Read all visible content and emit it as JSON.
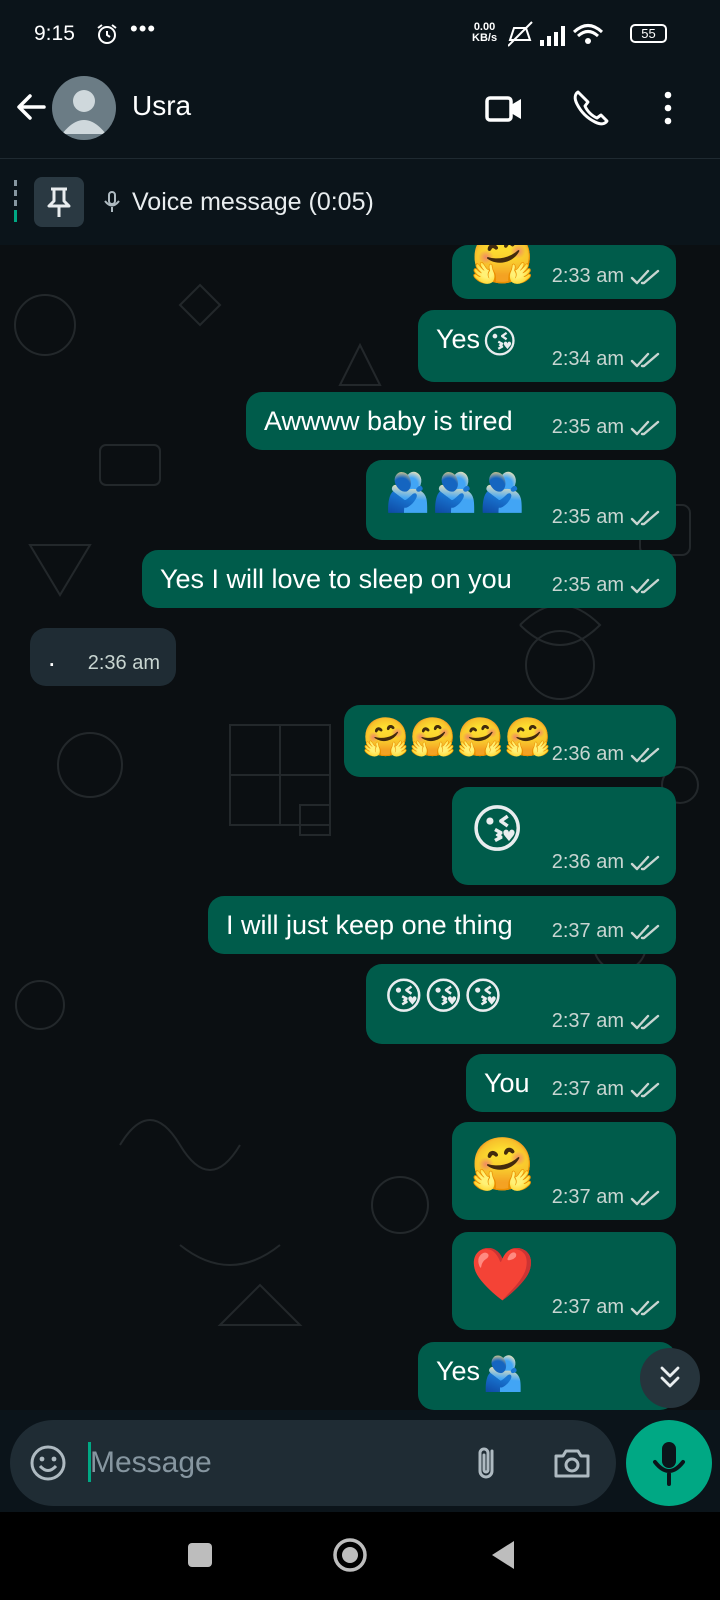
{
  "status_bar": {
    "time": "9:15",
    "dots": "•••",
    "net_speed_value": "0.00",
    "net_speed_unit": "KB/s",
    "battery": "55"
  },
  "header": {
    "contact_name": "Usra"
  },
  "pinned": {
    "text": "Voice message (0:05)"
  },
  "messages": [
    {
      "kind": "out",
      "text": "",
      "emoji": "🤗",
      "time": "2:33 am"
    },
    {
      "kind": "out",
      "text": "Yes",
      "emoji": "😘",
      "time": "2:34 am"
    },
    {
      "kind": "out",
      "text": "Awwww baby is tired",
      "emoji": "",
      "time": "2:35 am"
    },
    {
      "kind": "out",
      "text": "",
      "emoji": "🫂🫂🫂",
      "time": "2:35 am"
    },
    {
      "kind": "out",
      "text": "Yes I will love to sleep on you",
      "emoji": "",
      "time": "2:35 am"
    },
    {
      "kind": "in",
      "text": ".",
      "emoji": "",
      "time": "2:36 am"
    },
    {
      "kind": "out",
      "text": "",
      "emoji": "🤗🤗🤗🤗",
      "time": "2:36 am"
    },
    {
      "kind": "out",
      "text": "",
      "emoji": "😘",
      "time": "2:36 am"
    },
    {
      "kind": "out",
      "text": "I will just keep one thing",
      "emoji": "",
      "time": "2:37 am"
    },
    {
      "kind": "out",
      "text": "",
      "emoji": "😘😘😘",
      "time": "2:37 am"
    },
    {
      "kind": "out",
      "text": "You",
      "emoji": "",
      "time": "2:37 am"
    },
    {
      "kind": "out",
      "text": "",
      "emoji": "🤗",
      "time": "2:37 am"
    },
    {
      "kind": "out",
      "text": "",
      "emoji": "❤️",
      "time": "2:37 am"
    },
    {
      "kind": "out",
      "text": "Yes",
      "emoji": "🫂",
      "time": ""
    }
  ],
  "input": {
    "placeholder": "Message"
  },
  "colors": {
    "outgoing_bubble": "#005c4b",
    "incoming_bubble": "#1f2c34",
    "accent": "#00a884",
    "read_ticks": "#c8d5d1"
  },
  "icons": {
    "header": [
      "back-arrow-icon",
      "avatar",
      "video-call-icon",
      "phone-icon",
      "more-vert-icon"
    ],
    "input": [
      "emoji-icon",
      "attach-icon",
      "camera-icon",
      "mic-icon"
    ],
    "nav": [
      "recents-icon",
      "home-icon",
      "back-icon"
    ]
  }
}
